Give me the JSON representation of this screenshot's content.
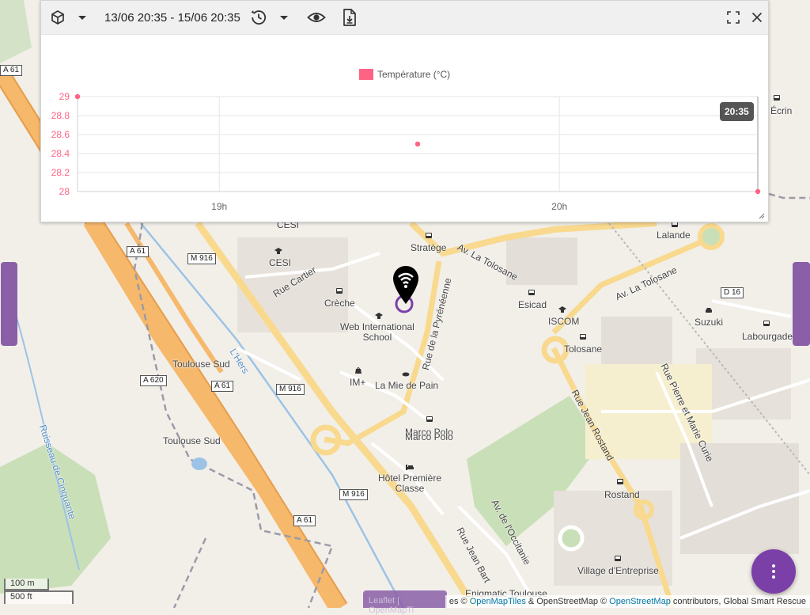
{
  "colors": {
    "series": "#ff6384",
    "accent": "#7b3fa8",
    "side_tab": "#8a5fa8",
    "highway": "#f6b86b",
    "secondary_road": "#f8d98e",
    "river": "#9cc3e6",
    "park": "#c9dfb8"
  },
  "toolbar": {
    "date_range": "13/06 20:35 - 15/06 20:35",
    "icons": [
      "cube-icon",
      "chevron-down-icon",
      "history-icon",
      "chevron-down-icon",
      "eye-icon",
      "file-download-icon",
      "fullscreen-icon",
      "close-icon"
    ]
  },
  "chart_data": {
    "type": "line",
    "show_line": false,
    "series": [
      {
        "name": "Température (°C)",
        "color": "#ff6384",
        "points": [
          {
            "x": "18:35",
            "y": 29.0
          },
          {
            "x": "19:35",
            "y": 28.5
          },
          {
            "x": "20:35",
            "y": 28.0
          }
        ]
      }
    ],
    "x_ticks": [
      "19h",
      "20h"
    ],
    "y_ticks": [
      "29",
      "28.8",
      "28.6",
      "28.4",
      "28.2",
      "28"
    ],
    "ylim": [
      28,
      29
    ],
    "grid": true,
    "legend_position": "top",
    "tooltip": "20:35"
  },
  "map": {
    "labels": [
      {
        "name": "label-crip",
        "text": "CESI",
        "sub": ""
      },
      {
        "name": "label-cesi",
        "text": "CESI",
        "sub": ""
      },
      {
        "name": "label-strategie",
        "text": "Stratège",
        "sub": ""
      },
      {
        "name": "label-creche",
        "text": "Crèche",
        "sub": ""
      },
      {
        "name": "label-web-school",
        "text": "Web International",
        "sub": "School"
      },
      {
        "name": "label-im-plus",
        "text": "IM+",
        "sub": ""
      },
      {
        "name": "label-mie-de-pain",
        "text": "La Mie de Pain",
        "sub": ""
      },
      {
        "name": "label-marco-polo-1",
        "text": "Marco Polo",
        "sub": ""
      },
      {
        "name": "label-marco-polo-2",
        "text": "Marco Polo",
        "sub": ""
      },
      {
        "name": "label-hotel",
        "text": "Hôtel Première",
        "sub": "Classe"
      },
      {
        "name": "label-enigmatic",
        "text": "Enigmatic Toulouse",
        "sub": ""
      },
      {
        "name": "label-esicad",
        "text": "Esicad",
        "sub": ""
      },
      {
        "name": "label-iscom",
        "text": "ISCOM",
        "sub": ""
      },
      {
        "name": "label-tolosane",
        "text": "Tolosane",
        "sub": ""
      },
      {
        "name": "label-lalande",
        "text": "Lalande",
        "sub": ""
      },
      {
        "name": "label-suzuki",
        "text": "Suzuki",
        "sub": ""
      },
      {
        "name": "label-labourgade",
        "text": "Labourgade",
        "sub": ""
      },
      {
        "name": "label-ecrin",
        "text": "Écrin",
        "sub": ""
      },
      {
        "name": "label-rostand",
        "text": "Rostand",
        "sub": ""
      },
      {
        "name": "label-village",
        "text": "Village d'Entreprise",
        "sub": ""
      },
      {
        "name": "label-toulouse-sud-1",
        "text": "Toulouse Sud",
        "sub": ""
      },
      {
        "name": "label-toulouse-sud-2",
        "text": "Toulouse Sud",
        "sub": ""
      }
    ],
    "street_labels": {
      "rue_cartier": "Rue Cartier",
      "av_tolosane_1": "Av. La Tolosane",
      "av_tolosane_2": "Av. La Tolosane",
      "rue_pyreneenne": "Rue de la Pyrénéenne",
      "rue_jean_rostand": "Rue Jean Rostand",
      "rue_pierre_marie": "Rue Pierre et Marie Curie",
      "av_occitanie": "Av. de l'Occitanie",
      "rue_jean_bart": "Rue Jean Bart",
      "hers": "L'Hers",
      "ruisseau": "Ruisseau de Cinquante"
    },
    "shields": [
      "A 61",
      "A 61",
      "M 916",
      "A 620",
      "A 61",
      "M 916",
      "M 916",
      "A 61",
      "D 16"
    ]
  },
  "scale": {
    "metric": "100 m",
    "imperial": "500 ft"
  },
  "attribution": {
    "prefix": "es © ",
    "omt": "OpenMapTiles",
    "mid": " & OpenStreetMap © ",
    "osm": "OpenStreetMap",
    "suffix": " contributors, Global Smart Rescue"
  },
  "bottom_tab": {
    "label": "Leaflet | OpenMapTi"
  }
}
